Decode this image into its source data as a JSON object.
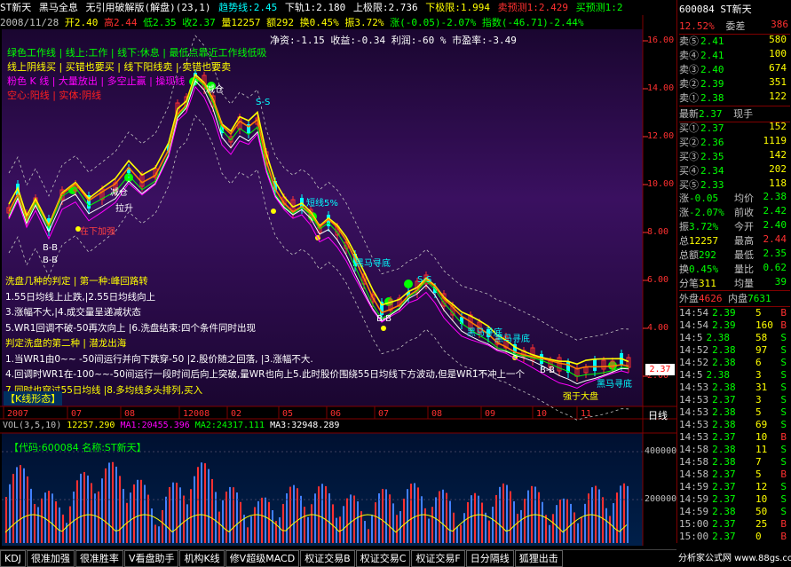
{
  "header": {
    "stock": "ST新天",
    "indicator": "黑马全息",
    "version": "无引用破解版(解盘)(23,1)",
    "trend_line": "趋势线:2.45",
    "lower1": "下轨1:2.180",
    "upper_limit": "上极限:2.736",
    "lower_limit": "下极限:1.994",
    "sell_forecast": "卖预测1:2.429",
    "buy_forecast": "买预测1:2",
    "date": "2008/11/28",
    "open": "开2.40",
    "high": "高2.44",
    "low": "低2.35",
    "close": "收2.37",
    "vol": "量12257",
    "amount": "额292",
    "turnover": "换0.45%",
    "amplitude": "振3.72%",
    "change": "涨(-0.05)-2.07%",
    "index": "指数(-46.71)-2.44%",
    "fin1": "净资:-1.15",
    "fin2": "收益:-0.34",
    "fin3": "利润:-60 %",
    "fin4": "市盈率:-3.49"
  },
  "legend": [
    {
      "text": "绿色工作线 | 线上:工作 | 线下:休息 | 最低点靠近工作线低吸",
      "color": "#00ff00"
    },
    {
      "text": "线上阴线买 | 买错也要买 | 线下阳线卖 | 卖错也要卖",
      "color": "#ffff00"
    },
    {
      "text": "粉色 K 线 | 大量放出 | 多空止赢 | 操现线",
      "color": "#ff00ff"
    },
    {
      "text": "空心:阳线 | 实体:阴线",
      "color": "#ff0000"
    }
  ],
  "notes": [
    {
      "text": "洗盘几种的判定 | 第一种:峰回路转",
      "color": "#ffff00"
    },
    {
      "text": "1.55日均线上止跌,|2.55日均线向上",
      "color": "#ffffff"
    },
    {
      "text": "3.涨幅不大,|4.成交量呈递减状态",
      "color": "#ffffff"
    },
    {
      "text": "5.WR1回调不破-50再次向上 |6.洗盘结束:四个条件同时出现",
      "color": "#ffffff"
    },
    {
      "text": "判定洗盘的第二种 | 潜龙出海",
      "color": "#ffff00"
    },
    {
      "text": "1.当WR1由0~~ -50间运行并向下跌穿-50 |2.股价随之回落, |3.涨幅不大.",
      "color": "#ffffff"
    },
    {
      "text": "4.回调时WR1在-100~~-50间运行一段时间后向上突破,量WR也向上5.此时股价围绕55日均线下方波动,但是WR1不冲上一个",
      "color": "#ffffff"
    },
    {
      "text": "7.同时也穿过55日均线 |8.多均线多头排列,买入",
      "color": "#ffffff"
    }
  ],
  "annotations": [
    {
      "text": "S-S",
      "color": "#00ffff"
    },
    {
      "text": "减仓",
      "color": "#ffffff"
    },
    {
      "text": "黑马寻底",
      "color": "#00ffff"
    },
    {
      "text": "短线5%",
      "color": "#00ffff"
    },
    {
      "text": "B-B",
      "color": "#ffffff"
    },
    {
      "text": "强于大盘",
      "color": "#ffff00"
    },
    {
      "text": "在下加强",
      "color": "#ff4040"
    },
    {
      "text": "B-B",
      "color": "#ffffff"
    },
    {
      "text": "黑马寻底",
      "color": "#00ffff"
    },
    {
      "text": "B-B",
      "color": "#ffffff"
    },
    {
      "text": "S-S",
      "color": "#00ffff"
    },
    {
      "text": "减仓",
      "color": "#ffffff"
    },
    {
      "text": "拉升",
      "color": "#ffffff"
    },
    {
      "text": "黑马寻底",
      "color": "#00ffff"
    },
    {
      "text": "黑马寻底",
      "color": "#00ffff"
    },
    {
      "text": "B-B",
      "color": "#ffffff"
    }
  ],
  "kline_label": "【K线形态】",
  "price_axis": [
    "16.00",
    "14.00",
    "12.00",
    "10.00",
    "8.00",
    "6.00",
    "4.00",
    "2.00"
  ],
  "current_price_tag": "2.37",
  "time_axis": [
    "2007",
    "07",
    "08",
    "12008",
    "02",
    "05",
    "06",
    "07",
    "08",
    "09",
    "10",
    "11"
  ],
  "period_label": "日线",
  "vol_header": {
    "vol": "VOL(3,5,10)",
    "v1": "12257.290",
    "ma1": "MA1:20455.396",
    "ma2": "MA2:24317.111",
    "ma3": "MA3:32948.289"
  },
  "vol_info": "【代码:600084 名称:ST新天】",
  "vol_axis": [
    "400000",
    "200000"
  ],
  "tabs": [
    "KDJ",
    "很准加强",
    "很准胜率",
    "V看盘助手",
    "机构K线",
    "修V超级MACD",
    "权证交易B",
    "权证交易C",
    "权证交易F",
    "日分隔线",
    "狐狸出击"
  ],
  "panel": {
    "code": "600084",
    "name": "ST新天",
    "ratio_label": "委比",
    "ratio": "12.52%",
    "diff_label": "委差",
    "diff": "386",
    "sells": [
      {
        "label": "卖⑤",
        "price": "2.41",
        "vol": "580"
      },
      {
        "label": "卖④",
        "price": "2.41",
        "vol": "100"
      },
      {
        "label": "卖③",
        "price": "2.40",
        "vol": "674"
      },
      {
        "label": "卖②",
        "price": "2.39",
        "vol": "351"
      },
      {
        "label": "卖①",
        "price": "2.38",
        "vol": "122"
      }
    ],
    "latest_label": "最新",
    "latest": "2.37",
    "hand_label": "现手",
    "buys": [
      {
        "label": "买①",
        "price": "2.37",
        "vol": "152"
      },
      {
        "label": "买②",
        "price": "2.36",
        "vol": "1119"
      },
      {
        "label": "买③",
        "price": "2.35",
        "vol": "142"
      },
      {
        "label": "买④",
        "price": "2.34",
        "vol": "202"
      },
      {
        "label": "买⑤",
        "price": "2.33",
        "vol": "118"
      }
    ],
    "stats": [
      [
        "涨",
        "-0.05",
        "均价",
        "2.38"
      ],
      [
        "涨",
        "-2.07%",
        "前收",
        "2.42"
      ],
      [
        "振",
        "3.72%",
        "今开",
        "2.40"
      ],
      [
        "总",
        "12257",
        "最高",
        "2.44"
      ],
      [
        "总额",
        "292",
        "最低",
        "2.35"
      ],
      [
        "换",
        "0.45%",
        "量比",
        "0.62"
      ],
      [
        "分笔",
        "311",
        "均量",
        "39"
      ]
    ],
    "outer_label": "外盘",
    "outer": "4626",
    "inner_label": "内盘",
    "inner": "7631",
    "ticks": [
      [
        "14:54",
        "2.39",
        "5",
        "B"
      ],
      [
        "14:54",
        "2.39",
        "160",
        "B"
      ],
      [
        "14:5",
        "2.38",
        "58",
        "S"
      ],
      [
        "14:52",
        "2.38",
        "97",
        "S"
      ],
      [
        "14:52",
        "2.38",
        "6",
        "S"
      ],
      [
        "14:5",
        "2.38",
        "3",
        "S"
      ],
      [
        "14:53",
        "2.38",
        "31",
        "S"
      ],
      [
        "14:53",
        "2.37",
        "3",
        "S"
      ],
      [
        "14:53",
        "2.38",
        "5",
        "S"
      ],
      [
        "14:53",
        "2.38",
        "69",
        "S"
      ],
      [
        "14:53",
        "2.37",
        "10",
        "B"
      ],
      [
        "14:58",
        "2.38",
        "11",
        "S"
      ],
      [
        "14:58",
        "2.38",
        "7",
        "S"
      ],
      [
        "14:58",
        "2.37",
        "5",
        "B"
      ],
      [
        "14:59",
        "2.37",
        "12",
        "S"
      ],
      [
        "14:59",
        "2.37",
        "10",
        "S"
      ],
      [
        "14:59",
        "2.38",
        "50",
        "S"
      ],
      [
        "15:00",
        "2.37",
        "25",
        "B"
      ],
      [
        "15:00",
        "2.37",
        "0",
        "B"
      ]
    ],
    "watermark": "分析家公式网 www.88gs.com"
  },
  "colors": {
    "bg": "#000000",
    "purple_bg": "#2a0a3a",
    "vol_bg": "#001c3a",
    "red": "#ff0000",
    "green": "#00ff00",
    "yellow": "#ffff00",
    "cyan": "#00ffff",
    "blue": "#3050ff"
  }
}
